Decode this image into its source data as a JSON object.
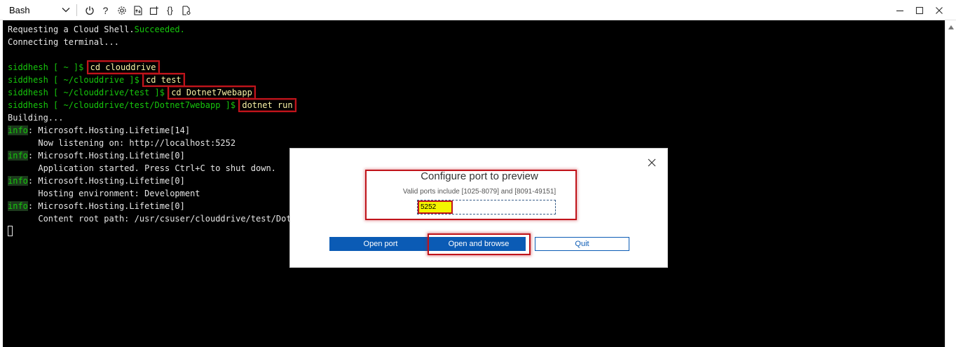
{
  "toolbar": {
    "shell": "Bash",
    "icons": [
      "power-icon",
      "help-icon",
      "settings-icon",
      "upload-download-icon",
      "new-session-icon",
      "braces-icon",
      "web-preview-icon"
    ],
    "help_glyph": "?",
    "braces_glyph": "{}"
  },
  "terminal": {
    "l1_a": "Requesting a Cloud Shell.",
    "l1_b": "Succeeded.",
    "l2": "Connecting terminal...",
    "prompt_user": "siddhesh",
    "p1_path": " [ ~ ]$",
    "p1_cmd": "cd clouddrive",
    "p2_path": " [ ~/clouddrive ]$",
    "p2_cmd": "cd test",
    "p3_path": " [ ~/clouddrive/test ]$",
    "p3_cmd": "cd Dotnet7webapp",
    "p4_path": " [ ~/clouddrive/test/Dotnet7webapp ]$",
    "p4_cmd": "dotnet run",
    "building": "Building...",
    "info": "info",
    "log1_head": ": Microsoft.Hosting.Lifetime[14]",
    "log1_body": "      Now listening on: http://localhost:5252",
    "log2_head": ": Microsoft.Hosting.Lifetime[0]",
    "log2_body": "      Application started. Press Ctrl+C to shut down.",
    "log3_head": ": Microsoft.Hosting.Lifetime[0]",
    "log3_body": "      Hosting environment: Development",
    "log4_head": ": Microsoft.Hosting.Lifetime[0]",
    "log4_body": "      Content root path: /usr/csuser/clouddrive/test/Dotnet"
  },
  "dialog": {
    "title": "Configure port to preview",
    "subtitle": "Valid ports include [1025-8079] and [8091-49151]",
    "port_value": "5252",
    "open_port": "Open port",
    "open_browse": "Open and browse",
    "quit": "Quit"
  },
  "colors": {
    "accent": "#0b5bb5",
    "highlight": "#c0141b",
    "terminal_bg": "#000000",
    "prompt_green": "#16c60c"
  }
}
